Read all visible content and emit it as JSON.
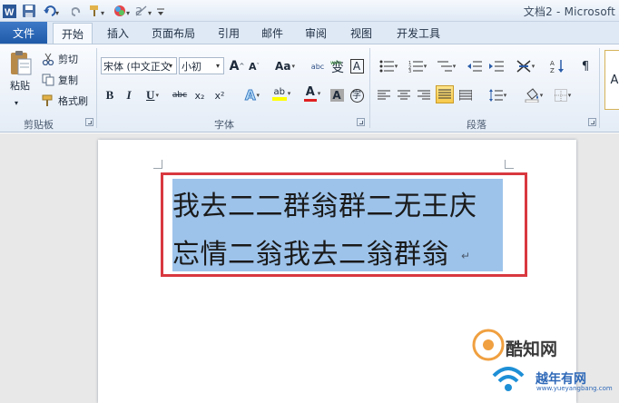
{
  "window": {
    "title": "文档2 - Microsoft"
  },
  "quick_access": {
    "icons": [
      "word-logo-icon",
      "save-icon",
      "undo-icon",
      "redo-icon",
      "format-painter-icon",
      "color-icon",
      "clear-icon",
      "customize-icon"
    ]
  },
  "tabs": {
    "file": "文件",
    "items": [
      "开始",
      "插入",
      "页面布局",
      "引用",
      "邮件",
      "审阅",
      "视图",
      "开发工具"
    ],
    "active": "开始"
  },
  "clipboard": {
    "paste": "粘贴",
    "cut": "剪切",
    "copy": "复制",
    "painter": "格式刷",
    "label": "剪贴板"
  },
  "font": {
    "name": "宋体 (中文正文",
    "size": "小初",
    "grow": "A",
    "shrink": "A",
    "case": "Aa",
    "phonetic": "abc",
    "char_border": "A",
    "bold": "B",
    "italic": "I",
    "underline": "U",
    "strike": "abc",
    "subscript": "x₂",
    "superscript": "x²",
    "effects": "A",
    "highlight_letters": "ab",
    "color": "A",
    "shading": "A",
    "enclose": "字",
    "label": "字体"
  },
  "paragraph": {
    "label": "段落"
  },
  "styles": {
    "preview": "A"
  },
  "document": {
    "line1": "我去二二群翁群二无王庆",
    "line2": "忘情二翁我去二翁群翁",
    "para_mark": "↵"
  },
  "watermark": {
    "brand1": "酷知网",
    "brand2": "越年有网",
    "url": "www.yueyangbang.com"
  },
  "colors": {
    "accent": "#1f5aa8",
    "selection": "#9dc3ea",
    "frame": "#d9383f"
  }
}
